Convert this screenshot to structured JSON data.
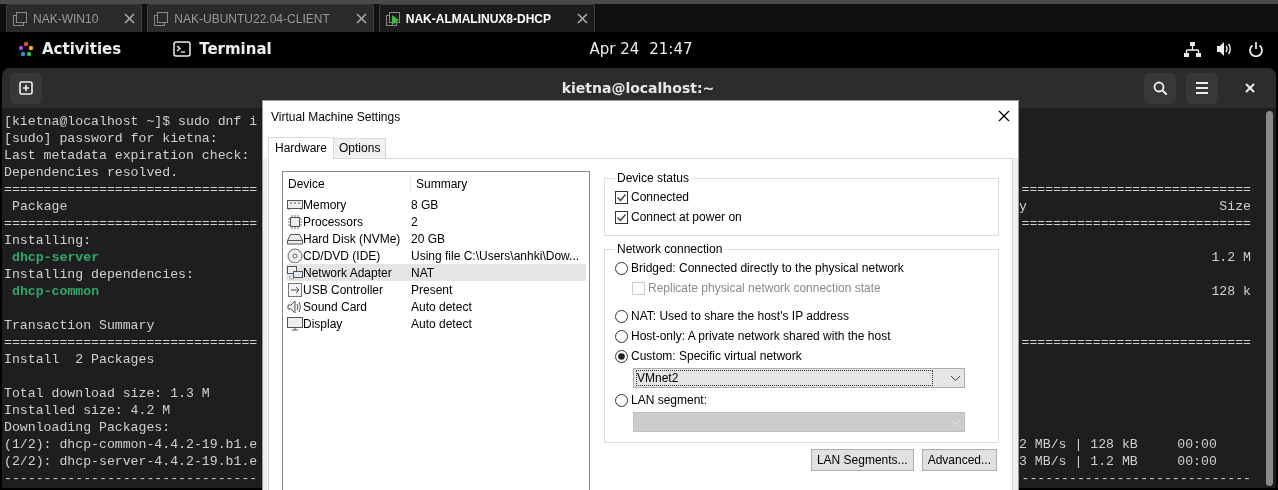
{
  "browser_tabs": [
    {
      "label": "NAK-WIN10",
      "selected": false
    },
    {
      "label": "NAK-UBUNTU22.04-CLIENT",
      "selected": false
    },
    {
      "label": "NAK-ALMALINUX8-DHCP",
      "selected": true
    }
  ],
  "top_bar": {
    "activities": "Activities",
    "app": "Terminal",
    "date": "Apr 24",
    "time": "21:47"
  },
  "terminal": {
    "title": "kietna@localhost:~",
    "lines": [
      {
        "kind": "text",
        "left": "[kietna@localhost ~]$ sudo dnf i"
      },
      {
        "kind": "text",
        "left": "[sudo] password for kietna:"
      },
      {
        "kind": "text",
        "left": "Last metadata expiration check:"
      },
      {
        "kind": "text",
        "left": "Dependencies resolved."
      },
      {
        "kind": "separator",
        "left": "================================",
        "right": [
          "============================="
        ]
      },
      {
        "kind": "header",
        "left": "Package",
        "right": [
          "y",
          "Size"
        ]
      },
      {
        "kind": "separator",
        "left": "================================",
        "right": [
          "============================="
        ]
      },
      {
        "kind": "text",
        "left": "Installing:"
      },
      {
        "kind": "package",
        "left": "dhcp-server",
        "right": [
          "1.2 M"
        ]
      },
      {
        "kind": "text",
        "left": "Installing dependencies:"
      },
      {
        "kind": "package",
        "left": "dhcp-common",
        "right": [
          "128 k"
        ]
      },
      {
        "kind": "blank"
      },
      {
        "kind": "text",
        "left": "Transaction Summary"
      },
      {
        "kind": "separator",
        "left": "================================",
        "right": [
          "============================="
        ]
      },
      {
        "kind": "text",
        "left": "Install  2 Packages"
      },
      {
        "kind": "blank"
      },
      {
        "kind": "text",
        "left": "Total download size: 1.3 M"
      },
      {
        "kind": "text",
        "left": "Installed size: 4.2 M"
      },
      {
        "kind": "text",
        "left": "Downloading Packages:"
      },
      {
        "kind": "progress",
        "left": "(1/2): dhcp-common-4.4.2-19.b1.e",
        "right": [
          "2 MB/s | 128 kB     00:00"
        ]
      },
      {
        "kind": "progress",
        "left": "(2/2): dhcp-server-4.4.2-19.b1.e",
        "right": [
          "3 MB/s | 1.2 MB     00:00"
        ]
      },
      {
        "kind": "separator",
        "left": "--------------------------------",
        "right": [
          "-----------------------------"
        ]
      }
    ]
  },
  "dialog": {
    "title": "Virtual Machine Settings",
    "tabs": [
      {
        "label": "Hardware",
        "selected": true
      },
      {
        "label": "Options",
        "selected": false
      }
    ],
    "devices": {
      "columns": [
        "Device",
        "Summary"
      ],
      "rows": [
        {
          "kind": "memory",
          "name": "Memory",
          "summary": "8 GB",
          "selected": false
        },
        {
          "kind": "processor",
          "name": "Processors",
          "summary": "2",
          "selected": false
        },
        {
          "kind": "disk",
          "name": "Hard Disk (NVMe)",
          "summary": "20 GB",
          "selected": false
        },
        {
          "kind": "cd",
          "name": "CD/DVD (IDE)",
          "summary": "Using file C:\\Users\\anhki\\Dow...",
          "selected": false
        },
        {
          "kind": "network",
          "name": "Network Adapter",
          "summary": "NAT",
          "selected": true
        },
        {
          "kind": "usb",
          "name": "USB Controller",
          "summary": "Present",
          "selected": false
        },
        {
          "kind": "sound",
          "name": "Sound Card",
          "summary": "Auto detect",
          "selected": false
        },
        {
          "kind": "display",
          "name": "Display",
          "summary": "Auto detect",
          "selected": false
        }
      ]
    },
    "device_status": {
      "legend": "Device status",
      "checks": [
        {
          "label": "Connected",
          "checked": true
        },
        {
          "label": "Connect at power on",
          "checked": true
        }
      ]
    },
    "network_connection": {
      "legend": "Network connection",
      "options": [
        {
          "label": "Bridged: Connected directly to the physical network",
          "selected": false,
          "sub": {
            "kind": "checkbox",
            "label": "Replicate physical network connection state",
            "checked": false,
            "disabled": true
          }
        },
        {
          "label": "NAT: Used to share the host's IP address",
          "selected": false
        },
        {
          "label": "Host-only: A private network shared with the host",
          "selected": false
        },
        {
          "label": "Custom: Specific virtual network",
          "selected": true,
          "sub": {
            "kind": "dropdown",
            "value": "VMnet2",
            "disabled": false
          }
        },
        {
          "label": "LAN segment:",
          "selected": false,
          "sub": {
            "kind": "dropdown",
            "disabled": true
          }
        }
      ]
    },
    "buttons": [
      "LAN Segments...",
      "Advanced..."
    ]
  }
}
